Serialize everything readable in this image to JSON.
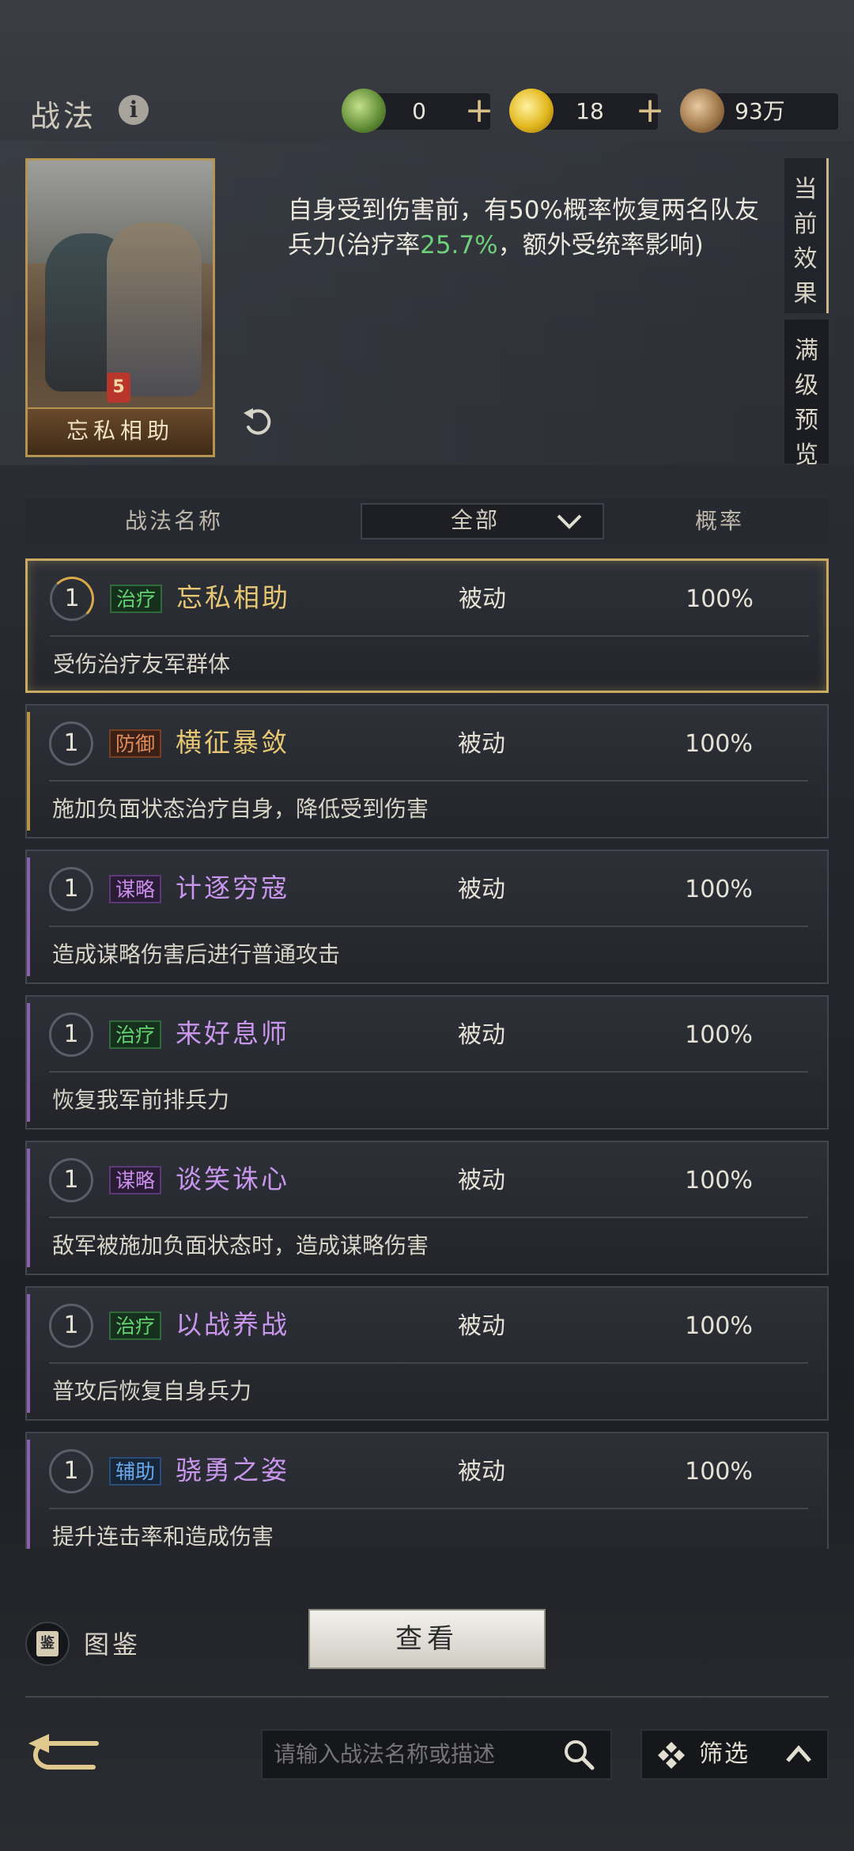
{
  "header": {
    "title": "战法",
    "info_icon": "i",
    "resources": [
      {
        "name": "jade",
        "icon": "jade-coin-icon",
        "value": "0"
      },
      {
        "name": "gold",
        "icon": "gold-coin-icon",
        "value": "18"
      },
      {
        "name": "copper",
        "icon": "copper-coin-icon",
        "value": "93万"
      }
    ],
    "plus": "+"
  },
  "hero": {
    "card_name": "忘私相助",
    "card_emblem": "5",
    "desc_part1": "自身受到伤害前，有50%概率恢复两名队友兵力(治疗率",
    "desc_highlight": "25.7%",
    "desc_part2": "，额外受统率影响)",
    "tab_current": "当前效果",
    "tab_max": "满级预览"
  },
  "table": {
    "col_name": "战法名称",
    "filter_value": "全部",
    "col_rate": "概率"
  },
  "skills": [
    {
      "level": "1",
      "tag": "治疗",
      "name": "忘私相助",
      "type": "被动",
      "rate": "100%",
      "desc": "受伤治疗友军群体"
    },
    {
      "level": "1",
      "tag": "防御",
      "name": "横征暴敛",
      "type": "被动",
      "rate": "100%",
      "desc": "施加负面状态治疗自身，降低受到伤害"
    },
    {
      "level": "1",
      "tag": "谋略",
      "name": "计逐穷寇",
      "type": "被动",
      "rate": "100%",
      "desc": "造成谋略伤害后进行普通攻击"
    },
    {
      "level": "1",
      "tag": "治疗",
      "name": "来好息师",
      "type": "被动",
      "rate": "100%",
      "desc": "恢复我军前排兵力"
    },
    {
      "level": "1",
      "tag": "谋略",
      "name": "谈笑诛心",
      "type": "被动",
      "rate": "100%",
      "desc": "敌军被施加负面状态时，造成谋略伤害"
    },
    {
      "level": "1",
      "tag": "治疗",
      "name": "以战养战",
      "type": "被动",
      "rate": "100%",
      "desc": "普攻后恢复自身兵力"
    },
    {
      "level": "1",
      "tag": "辅助",
      "name": "骁勇之姿",
      "type": "被动",
      "rate": "100%",
      "desc": "提升连击率和造成伤害"
    }
  ],
  "bottom": {
    "book_icon_text": "鉴",
    "book_label": "图鉴",
    "view_button": "查看",
    "search_placeholder": "请输入战法名称或描述",
    "filter_label": "筛选"
  },
  "colors": {
    "gold_border": "#c8aa62",
    "heal_green": "#62d472",
    "strategy_purple": "#c88ee8",
    "defense_orange": "#e08c5b",
    "aux_blue": "#6ba9ec"
  }
}
